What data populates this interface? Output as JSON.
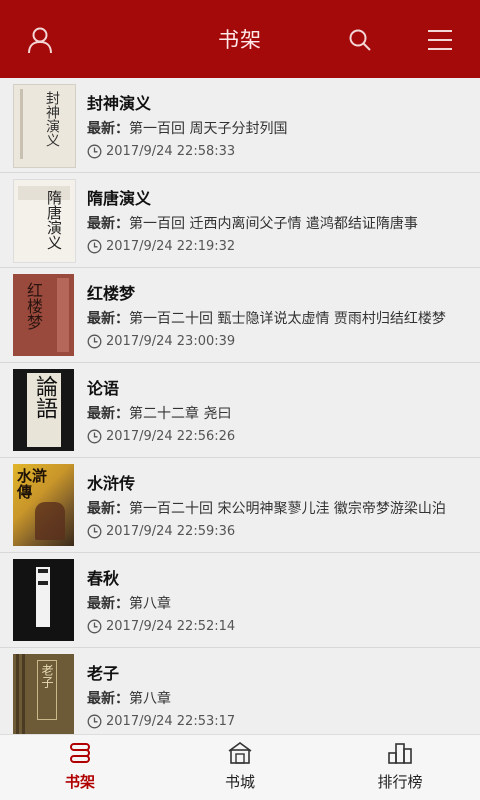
{
  "header": {
    "title": "书架"
  },
  "books": [
    {
      "title": "封神演义",
      "latest_label": "最新：",
      "latest_text": "第一百回 周天子分封列国",
      "time": "2017/9/24 22:58:33"
    },
    {
      "title": "隋唐演义",
      "latest_label": "最新：",
      "latest_text": "第一百回 迁西内离间父子情 遣鸿都结证隋唐事",
      "time": "2017/9/24 22:19:32"
    },
    {
      "title": "红楼梦",
      "latest_label": "最新：",
      "latest_text": "第一百二十回 甄士隐详说太虚情 贾雨村归结红楼梦",
      "time": "2017/9/24 23:00:39"
    },
    {
      "title": "论语",
      "latest_label": "最新：",
      "latest_text": "第二十二章 尧曰",
      "time": "2017/9/24 22:56:26"
    },
    {
      "title": "水浒传",
      "latest_label": "最新：",
      "latest_text": "第一百二十回 宋公明神聚蓼儿洼 徽宗帝梦游梁山泊",
      "time": "2017/9/24 22:59:36"
    },
    {
      "title": "春秋",
      "latest_label": "最新：",
      "latest_text": "第八章",
      "time": "2017/9/24 22:52:14"
    },
    {
      "title": "老子",
      "latest_label": "最新：",
      "latest_text": "第八章",
      "time": "2017/9/24 22:53:17"
    }
  ],
  "tabs": [
    {
      "label": "书架",
      "icon": "bookshelf-icon",
      "active": true
    },
    {
      "label": "书城",
      "icon": "bookstore-icon",
      "active": false
    },
    {
      "label": "排行榜",
      "icon": "ranking-icon",
      "active": false
    }
  ],
  "colors": {
    "header": "#a50a0a",
    "active_tab": "#b00000",
    "background": "#efefef"
  }
}
